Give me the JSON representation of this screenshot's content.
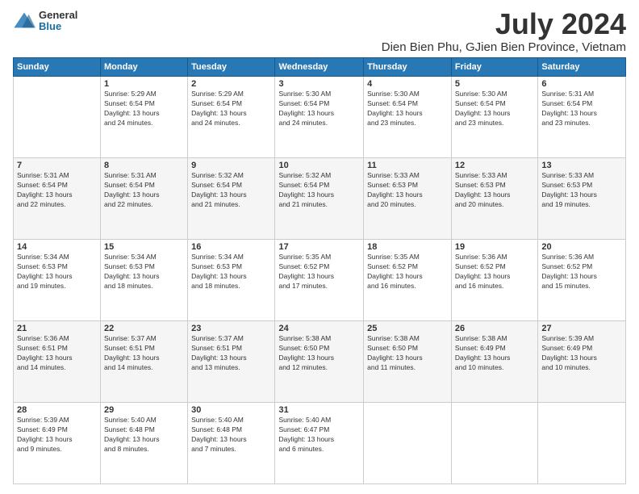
{
  "logo": {
    "general": "General",
    "blue": "Blue"
  },
  "title": "July 2024",
  "subtitle": "Dien Bien Phu, GJien Bien Province, Vietnam",
  "days_of_week": [
    "Sunday",
    "Monday",
    "Tuesday",
    "Wednesday",
    "Thursday",
    "Friday",
    "Saturday"
  ],
  "weeks": [
    [
      {
        "day": "",
        "info": ""
      },
      {
        "day": "1",
        "info": "Sunrise: 5:29 AM\nSunset: 6:54 PM\nDaylight: 13 hours\nand 24 minutes."
      },
      {
        "day": "2",
        "info": "Sunrise: 5:29 AM\nSunset: 6:54 PM\nDaylight: 13 hours\nand 24 minutes."
      },
      {
        "day": "3",
        "info": "Sunrise: 5:30 AM\nSunset: 6:54 PM\nDaylight: 13 hours\nand 24 minutes."
      },
      {
        "day": "4",
        "info": "Sunrise: 5:30 AM\nSunset: 6:54 PM\nDaylight: 13 hours\nand 23 minutes."
      },
      {
        "day": "5",
        "info": "Sunrise: 5:30 AM\nSunset: 6:54 PM\nDaylight: 13 hours\nand 23 minutes."
      },
      {
        "day": "6",
        "info": "Sunrise: 5:31 AM\nSunset: 6:54 PM\nDaylight: 13 hours\nand 23 minutes."
      }
    ],
    [
      {
        "day": "7",
        "info": "Sunrise: 5:31 AM\nSunset: 6:54 PM\nDaylight: 13 hours\nand 22 minutes."
      },
      {
        "day": "8",
        "info": "Sunrise: 5:31 AM\nSunset: 6:54 PM\nDaylight: 13 hours\nand 22 minutes."
      },
      {
        "day": "9",
        "info": "Sunrise: 5:32 AM\nSunset: 6:54 PM\nDaylight: 13 hours\nand 21 minutes."
      },
      {
        "day": "10",
        "info": "Sunrise: 5:32 AM\nSunset: 6:54 PM\nDaylight: 13 hours\nand 21 minutes."
      },
      {
        "day": "11",
        "info": "Sunrise: 5:33 AM\nSunset: 6:53 PM\nDaylight: 13 hours\nand 20 minutes."
      },
      {
        "day": "12",
        "info": "Sunrise: 5:33 AM\nSunset: 6:53 PM\nDaylight: 13 hours\nand 20 minutes."
      },
      {
        "day": "13",
        "info": "Sunrise: 5:33 AM\nSunset: 6:53 PM\nDaylight: 13 hours\nand 19 minutes."
      }
    ],
    [
      {
        "day": "14",
        "info": "Sunrise: 5:34 AM\nSunset: 6:53 PM\nDaylight: 13 hours\nand 19 minutes."
      },
      {
        "day": "15",
        "info": "Sunrise: 5:34 AM\nSunset: 6:53 PM\nDaylight: 13 hours\nand 18 minutes."
      },
      {
        "day": "16",
        "info": "Sunrise: 5:34 AM\nSunset: 6:53 PM\nDaylight: 13 hours\nand 18 minutes."
      },
      {
        "day": "17",
        "info": "Sunrise: 5:35 AM\nSunset: 6:52 PM\nDaylight: 13 hours\nand 17 minutes."
      },
      {
        "day": "18",
        "info": "Sunrise: 5:35 AM\nSunset: 6:52 PM\nDaylight: 13 hours\nand 16 minutes."
      },
      {
        "day": "19",
        "info": "Sunrise: 5:36 AM\nSunset: 6:52 PM\nDaylight: 13 hours\nand 16 minutes."
      },
      {
        "day": "20",
        "info": "Sunrise: 5:36 AM\nSunset: 6:52 PM\nDaylight: 13 hours\nand 15 minutes."
      }
    ],
    [
      {
        "day": "21",
        "info": "Sunrise: 5:36 AM\nSunset: 6:51 PM\nDaylight: 13 hours\nand 14 minutes."
      },
      {
        "day": "22",
        "info": "Sunrise: 5:37 AM\nSunset: 6:51 PM\nDaylight: 13 hours\nand 14 minutes."
      },
      {
        "day": "23",
        "info": "Sunrise: 5:37 AM\nSunset: 6:51 PM\nDaylight: 13 hours\nand 13 minutes."
      },
      {
        "day": "24",
        "info": "Sunrise: 5:38 AM\nSunset: 6:50 PM\nDaylight: 13 hours\nand 12 minutes."
      },
      {
        "day": "25",
        "info": "Sunrise: 5:38 AM\nSunset: 6:50 PM\nDaylight: 13 hours\nand 11 minutes."
      },
      {
        "day": "26",
        "info": "Sunrise: 5:38 AM\nSunset: 6:49 PM\nDaylight: 13 hours\nand 10 minutes."
      },
      {
        "day": "27",
        "info": "Sunrise: 5:39 AM\nSunset: 6:49 PM\nDaylight: 13 hours\nand 10 minutes."
      }
    ],
    [
      {
        "day": "28",
        "info": "Sunrise: 5:39 AM\nSunset: 6:49 PM\nDaylight: 13 hours\nand 9 minutes."
      },
      {
        "day": "29",
        "info": "Sunrise: 5:40 AM\nSunset: 6:48 PM\nDaylight: 13 hours\nand 8 minutes."
      },
      {
        "day": "30",
        "info": "Sunrise: 5:40 AM\nSunset: 6:48 PM\nDaylight: 13 hours\nand 7 minutes."
      },
      {
        "day": "31",
        "info": "Sunrise: 5:40 AM\nSunset: 6:47 PM\nDaylight: 13 hours\nand 6 minutes."
      },
      {
        "day": "",
        "info": ""
      },
      {
        "day": "",
        "info": ""
      },
      {
        "day": "",
        "info": ""
      }
    ]
  ]
}
